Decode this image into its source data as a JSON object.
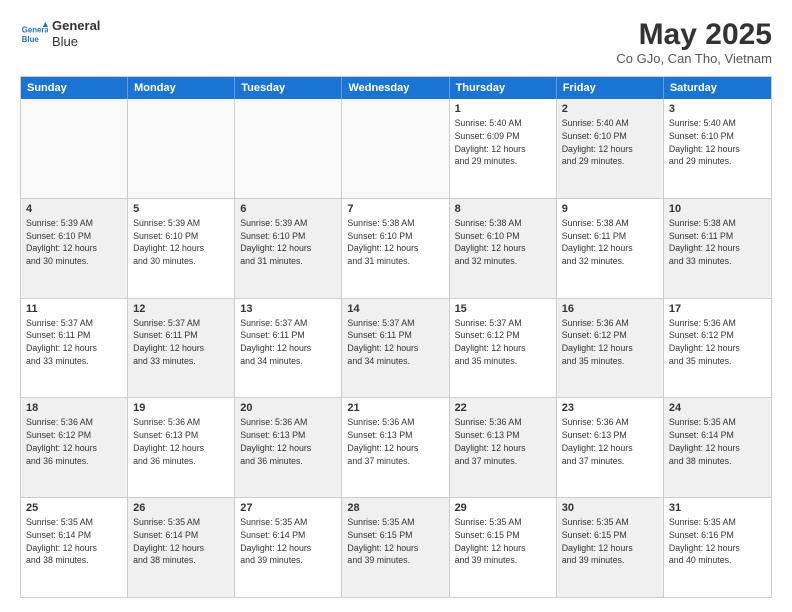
{
  "logo": {
    "line1": "General",
    "line2": "Blue"
  },
  "title": "May 2025",
  "subtitle": "Co GJo, Can Tho, Vietnam",
  "days": [
    "Sunday",
    "Monday",
    "Tuesday",
    "Wednesday",
    "Thursday",
    "Friday",
    "Saturday"
  ],
  "rows": [
    [
      {
        "day": "",
        "text": "",
        "empty": true
      },
      {
        "day": "",
        "text": "",
        "empty": true
      },
      {
        "day": "",
        "text": "",
        "empty": true
      },
      {
        "day": "",
        "text": "",
        "empty": true
      },
      {
        "day": "1",
        "text": "Sunrise: 5:40 AM\nSunset: 6:09 PM\nDaylight: 12 hours\nand 29 minutes."
      },
      {
        "day": "2",
        "text": "Sunrise: 5:40 AM\nSunset: 6:10 PM\nDaylight: 12 hours\nand 29 minutes.",
        "shaded": true
      },
      {
        "day": "3",
        "text": "Sunrise: 5:40 AM\nSunset: 6:10 PM\nDaylight: 12 hours\nand 29 minutes."
      }
    ],
    [
      {
        "day": "4",
        "text": "Sunrise: 5:39 AM\nSunset: 6:10 PM\nDaylight: 12 hours\nand 30 minutes.",
        "shaded": true
      },
      {
        "day": "5",
        "text": "Sunrise: 5:39 AM\nSunset: 6:10 PM\nDaylight: 12 hours\nand 30 minutes."
      },
      {
        "day": "6",
        "text": "Sunrise: 5:39 AM\nSunset: 6:10 PM\nDaylight: 12 hours\nand 31 minutes.",
        "shaded": true
      },
      {
        "day": "7",
        "text": "Sunrise: 5:38 AM\nSunset: 6:10 PM\nDaylight: 12 hours\nand 31 minutes."
      },
      {
        "day": "8",
        "text": "Sunrise: 5:38 AM\nSunset: 6:10 PM\nDaylight: 12 hours\nand 32 minutes.",
        "shaded": true
      },
      {
        "day": "9",
        "text": "Sunrise: 5:38 AM\nSunset: 6:11 PM\nDaylight: 12 hours\nand 32 minutes."
      },
      {
        "day": "10",
        "text": "Sunrise: 5:38 AM\nSunset: 6:11 PM\nDaylight: 12 hours\nand 33 minutes.",
        "shaded": true
      }
    ],
    [
      {
        "day": "11",
        "text": "Sunrise: 5:37 AM\nSunset: 6:11 PM\nDaylight: 12 hours\nand 33 minutes."
      },
      {
        "day": "12",
        "text": "Sunrise: 5:37 AM\nSunset: 6:11 PM\nDaylight: 12 hours\nand 33 minutes.",
        "shaded": true
      },
      {
        "day": "13",
        "text": "Sunrise: 5:37 AM\nSunset: 6:11 PM\nDaylight: 12 hours\nand 34 minutes."
      },
      {
        "day": "14",
        "text": "Sunrise: 5:37 AM\nSunset: 6:11 PM\nDaylight: 12 hours\nand 34 minutes.",
        "shaded": true
      },
      {
        "day": "15",
        "text": "Sunrise: 5:37 AM\nSunset: 6:12 PM\nDaylight: 12 hours\nand 35 minutes."
      },
      {
        "day": "16",
        "text": "Sunrise: 5:36 AM\nSunset: 6:12 PM\nDaylight: 12 hours\nand 35 minutes.",
        "shaded": true
      },
      {
        "day": "17",
        "text": "Sunrise: 5:36 AM\nSunset: 6:12 PM\nDaylight: 12 hours\nand 35 minutes."
      }
    ],
    [
      {
        "day": "18",
        "text": "Sunrise: 5:36 AM\nSunset: 6:12 PM\nDaylight: 12 hours\nand 36 minutes.",
        "shaded": true
      },
      {
        "day": "19",
        "text": "Sunrise: 5:36 AM\nSunset: 6:13 PM\nDaylight: 12 hours\nand 36 minutes."
      },
      {
        "day": "20",
        "text": "Sunrise: 5:36 AM\nSunset: 6:13 PM\nDaylight: 12 hours\nand 36 minutes.",
        "shaded": true
      },
      {
        "day": "21",
        "text": "Sunrise: 5:36 AM\nSunset: 6:13 PM\nDaylight: 12 hours\nand 37 minutes."
      },
      {
        "day": "22",
        "text": "Sunrise: 5:36 AM\nSunset: 6:13 PM\nDaylight: 12 hours\nand 37 minutes.",
        "shaded": true
      },
      {
        "day": "23",
        "text": "Sunrise: 5:36 AM\nSunset: 6:13 PM\nDaylight: 12 hours\nand 37 minutes."
      },
      {
        "day": "24",
        "text": "Sunrise: 5:35 AM\nSunset: 6:14 PM\nDaylight: 12 hours\nand 38 minutes.",
        "shaded": true
      }
    ],
    [
      {
        "day": "25",
        "text": "Sunrise: 5:35 AM\nSunset: 6:14 PM\nDaylight: 12 hours\nand 38 minutes."
      },
      {
        "day": "26",
        "text": "Sunrise: 5:35 AM\nSunset: 6:14 PM\nDaylight: 12 hours\nand 38 minutes.",
        "shaded": true
      },
      {
        "day": "27",
        "text": "Sunrise: 5:35 AM\nSunset: 6:14 PM\nDaylight: 12 hours\nand 39 minutes."
      },
      {
        "day": "28",
        "text": "Sunrise: 5:35 AM\nSunset: 6:15 PM\nDaylight: 12 hours\nand 39 minutes.",
        "shaded": true
      },
      {
        "day": "29",
        "text": "Sunrise: 5:35 AM\nSunset: 6:15 PM\nDaylight: 12 hours\nand 39 minutes."
      },
      {
        "day": "30",
        "text": "Sunrise: 5:35 AM\nSunset: 6:15 PM\nDaylight: 12 hours\nand 39 minutes.",
        "shaded": true
      },
      {
        "day": "31",
        "text": "Sunrise: 5:35 AM\nSunset: 6:16 PM\nDaylight: 12 hours\nand 40 minutes."
      }
    ]
  ]
}
